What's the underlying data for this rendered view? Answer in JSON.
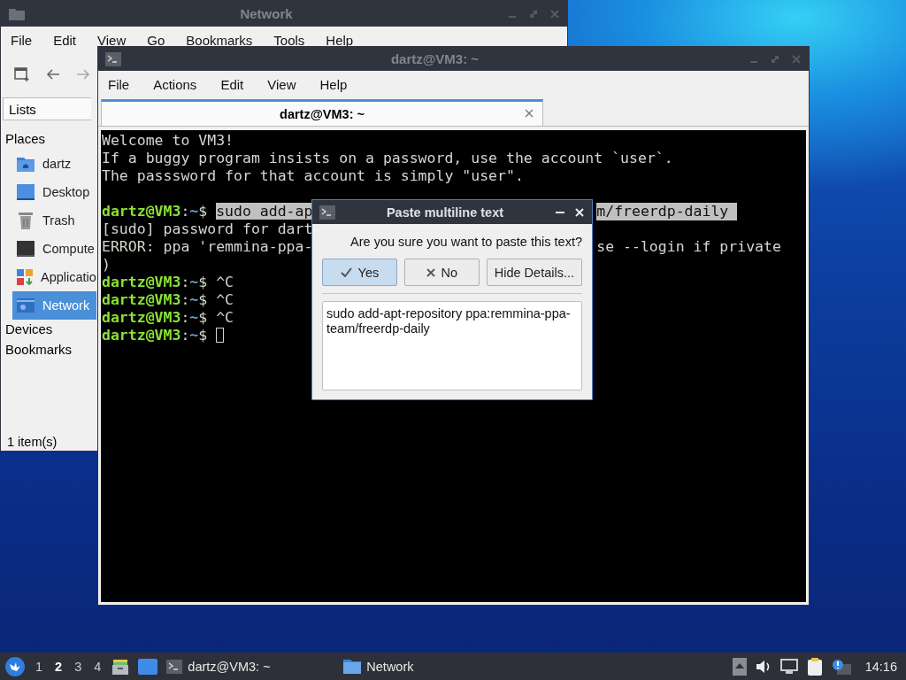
{
  "file_manager": {
    "title": "Network",
    "menu": [
      "File",
      "Edit",
      "View",
      "Go",
      "Bookmarks",
      "Tools",
      "Help"
    ],
    "side_tab": "Lists",
    "places_header": "Places",
    "places": [
      {
        "label": "dartz",
        "kind": "home",
        "selected": false
      },
      {
        "label": "Desktop",
        "kind": "desktop",
        "selected": false
      },
      {
        "label": "Trash",
        "kind": "trash",
        "selected": false
      },
      {
        "label": "Compute",
        "kind": "computer",
        "selected": false
      },
      {
        "label": "Applicatio",
        "kind": "apps",
        "selected": false
      },
      {
        "label": "Network",
        "kind": "network",
        "selected": true
      }
    ],
    "sections": [
      "Devices",
      "Bookmarks"
    ],
    "status": "1 item(s)"
  },
  "terminal": {
    "title": "dartz@VM3: ~",
    "menu": [
      "File",
      "Actions",
      "Edit",
      "View",
      "Help"
    ],
    "tabs": [
      {
        "label": "dartz@VM3: ~",
        "selected": true
      }
    ],
    "lines": [
      {
        "kind": "output",
        "text": "Welcome to VM3!"
      },
      {
        "kind": "output",
        "text": "If a buggy program insists on a password, use the account `user`."
      },
      {
        "kind": "output",
        "text": "The passsword for that account is simply \"user\"."
      },
      {
        "kind": "blank"
      },
      {
        "kind": "prompt",
        "user_host": "dartz@VM3",
        "separator": ":",
        "path": "~",
        "symbol": "$",
        "command": "sudo add-ap",
        "command_right": "m/freerdp-daily",
        "highlighted": true,
        "cursor": false
      },
      {
        "kind": "output",
        "text": "[sudo] password for dart"
      },
      {
        "kind": "output",
        "text": "ERROR: ppa 'remmina-ppa-",
        "text_right": "se --login if private"
      },
      {
        "kind": "output",
        "text": ")"
      },
      {
        "kind": "prompt",
        "user_host": "dartz@VM3",
        "separator": ":",
        "path": "~",
        "symbol": "$",
        "command": "^C",
        "highlighted": false,
        "cursor": false
      },
      {
        "kind": "prompt",
        "user_host": "dartz@VM3",
        "separator": ":",
        "path": "~",
        "symbol": "$",
        "command": "^C",
        "highlighted": false,
        "cursor": false
      },
      {
        "kind": "prompt",
        "user_host": "dartz@VM3",
        "separator": ":",
        "path": "~",
        "symbol": "$",
        "command": "^C",
        "highlighted": false,
        "cursor": false
      },
      {
        "kind": "prompt",
        "user_host": "dartz@VM3",
        "separator": ":",
        "path": "~",
        "symbol": "$",
        "cursor": true
      }
    ]
  },
  "dialog": {
    "title": "Paste multiline text",
    "question": "Are you sure you want to paste this text?",
    "buttons": [
      {
        "label": "Yes",
        "kind": "check",
        "selected": true
      },
      {
        "label": "No",
        "kind": "cross",
        "selected": false
      },
      {
        "label": "Hide Details...",
        "kind": "plain",
        "selected": false
      }
    ],
    "details": "sudo add-apt-repository ppa:remmina-ppa-team/freerdp-daily"
  },
  "taskbar": {
    "workspaces": [
      {
        "label": "1",
        "selected": false
      },
      {
        "label": "2",
        "selected": true
      },
      {
        "label": "3",
        "selected": false
      },
      {
        "label": "4",
        "selected": false
      }
    ],
    "tasks": [
      {
        "label": "dartz@VM3: ~",
        "kind": "terminal"
      },
      {
        "label": "Network",
        "kind": "folder"
      }
    ],
    "clock": "14:16"
  }
}
